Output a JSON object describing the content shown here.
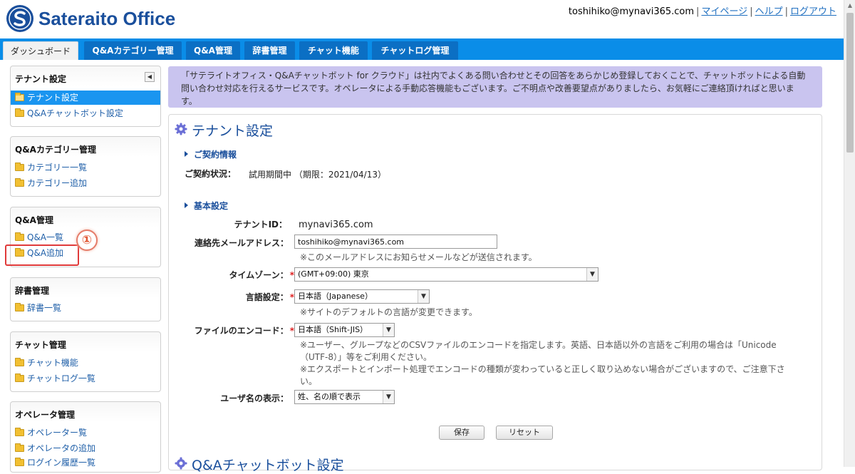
{
  "header": {
    "logo_text": "Sateraito Office",
    "user_email": "toshihiko@mynavi365.com",
    "links": [
      "マイページ",
      "ヘルプ",
      "ログアウト"
    ]
  },
  "tabs": [
    {
      "label": "ダッシュボード",
      "active": true
    },
    {
      "label": "Q&Aカテゴリー管理"
    },
    {
      "label": "Q&A管理"
    },
    {
      "label": "辞書管理"
    },
    {
      "label": "チャット機能"
    },
    {
      "label": "チャットログ管理"
    }
  ],
  "sidebar": {
    "tenant": {
      "title": "テナント設定",
      "items": [
        "テナント設定",
        "Q&Aチャットボット設定"
      ]
    },
    "qa_category": {
      "title": "Q&Aカテゴリー管理",
      "items": [
        "カテゴリー一覧",
        "カテゴリー追加"
      ]
    },
    "qa": {
      "title": "Q&A管理",
      "items": [
        "Q&A一覧",
        "Q&A追加"
      ]
    },
    "dictionary": {
      "title": "辞書管理",
      "items": [
        "辞書一覧"
      ]
    },
    "chat": {
      "title": "チャット管理",
      "items": [
        "チャット機能",
        "チャットログ一覧"
      ]
    },
    "operator": {
      "title": "オペレータ管理",
      "items": [
        "オペレーター覧",
        "オペレータの追加",
        "ログイン履歴一覧"
      ]
    }
  },
  "annotation": {
    "step": "①"
  },
  "notice": {
    "line1": "「サテライトオフィス・Q&Aチャットボット for クラウド」は社内でよくある問い合わせとその回答をあらかじめ登録しておくことで、チャットボットによる自動",
    "line2": "問い合わせ対応を行えるサービスです。オペレータによる手動応答機能もございます。ご不明点や改善要望点がありましたら、お気軽にご連絡頂ければと思いま",
    "line3": "す。"
  },
  "panel": {
    "title": "テナント設定",
    "contract_head": "ご契約情報",
    "contract_label": "ご契約状況：",
    "contract_value": "試用期間中 （期限：2021/04/13）",
    "basic_head": "基本設定",
    "tenant_id_label": "テナントID：",
    "tenant_id_value": "mynavi365.com",
    "email_label": "連絡先メールアドレス：",
    "email_value": "toshihiko@mynavi365.com",
    "email_note": "※このメールアドレスにお知らせメールなどが送信されます。",
    "timezone_label": "タイムゾーン：",
    "timezone_value": "(GMT+09:00) 東京",
    "language_label": "言語設定：",
    "language_value": "日本語（Japanese）",
    "language_note": "※サイトのデフォルトの言語が変更できます。",
    "encode_label": "ファイルのエンコード：",
    "encode_value": "日本語（Shift-JIS）",
    "encode_note1": "※ユーザー、グループなどのCSVファイルのエンコードを指定します。英語、日本語以外の言語をご利用の場合は「Unicode",
    "encode_note2": "（UTF-8）」等をご利用ください。",
    "encode_note3": "※エクスポートとインポート処理でエンコードの種類が変わっていると正しく取り込めない場合がございますので、ご注意下さ",
    "encode_note4": "い。",
    "username_label": "ユーザ名の表示：",
    "username_value": "姓、名の順で表示",
    "required_mark": "*",
    "save_label": "保存",
    "reset_label": "リセット",
    "next_section_title": "Q&Aチャットボット設定"
  }
}
